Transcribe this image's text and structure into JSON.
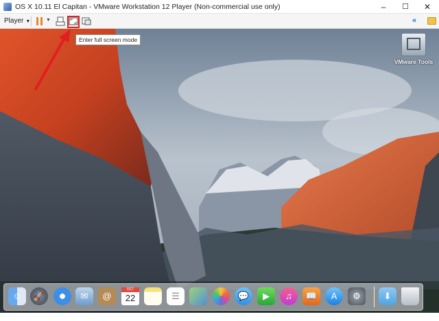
{
  "window": {
    "title": "OS X 10.11 El Capitan - VMware Workstation 12 Player (Non-commercial use only)",
    "minimize": "–",
    "maximize": "☐",
    "close": "✕"
  },
  "toolbar": {
    "player_menu_label": "Player",
    "player_caret": "▼",
    "pause_caret": "▼",
    "collapse": "«"
  },
  "tooltip": {
    "text": "Enter full screen mode"
  },
  "desktop": {
    "vmware_tools_label": "VMware Tools"
  },
  "dock": {
    "calendar_month": "OCT",
    "calendar_day": "22",
    "icons": [
      "finder-icon",
      "launchpad-icon",
      "safari-icon",
      "mail-icon",
      "contacts-icon",
      "calendar-icon",
      "notes-icon",
      "reminders-icon",
      "maps-icon",
      "photos-icon",
      "messages-icon",
      "facetime-icon",
      "itunes-icon",
      "ibooks-icon",
      "app-store-icon",
      "system-preferences-icon",
      "downloads-icon",
      "trash-icon"
    ]
  },
  "colors": {
    "accent_red": "#e02020",
    "pause_orange": "#e8862b",
    "collapse_blue": "#1e6fd9"
  }
}
